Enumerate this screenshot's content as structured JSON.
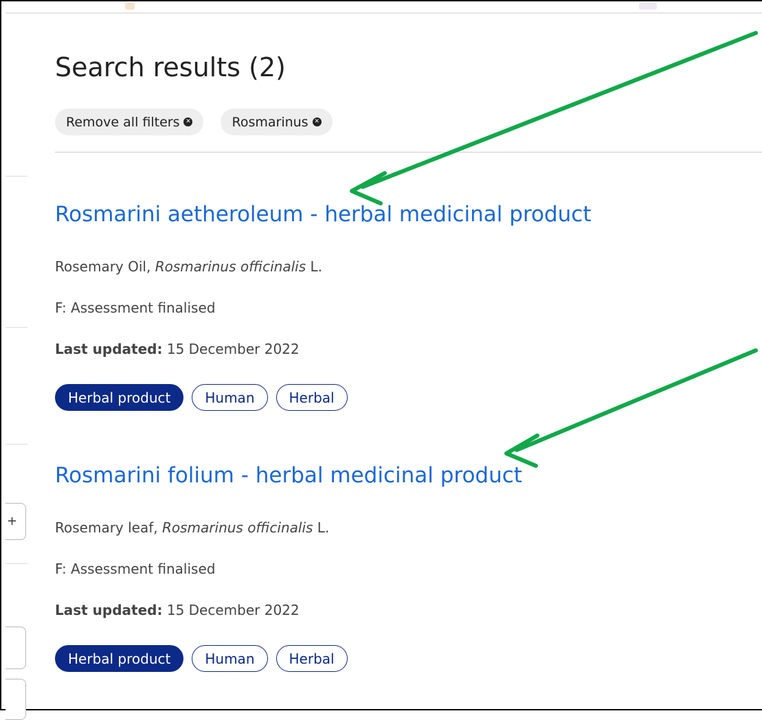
{
  "header": {
    "title": "Search results (2)"
  },
  "filters": [
    {
      "label": "Remove all filters"
    },
    {
      "label": "Rosmarinus"
    }
  ],
  "results": [
    {
      "title": "Rosmarini aetheroleum - herbal medicinal product",
      "common_name": "Rosemary Oil, ",
      "latin_name": "Rosmarinus officinalis",
      "author": " L.",
      "status": "F: Assessment finalised",
      "updated_label": "Last updated:",
      "updated_value": " 15 December 2022",
      "tags": [
        "Herbal product",
        "Human",
        "Herbal"
      ]
    },
    {
      "title": "Rosmarini folium - herbal medicinal product",
      "common_name": "Rosemary leaf, ",
      "latin_name": "Rosmarinus officinalis",
      "author": " L.",
      "status": "F: Assessment finalised",
      "updated_label": "Last updated:",
      "updated_value": " 15 December 2022",
      "tags": [
        "Herbal product",
        "Human",
        "Herbal"
      ]
    }
  ],
  "sidebar": {
    "expand_symbol": "+"
  },
  "colors": {
    "link": "#1a68d8",
    "tag_primary": "#0c2a87",
    "annotation_arrow": "#12a84a"
  }
}
